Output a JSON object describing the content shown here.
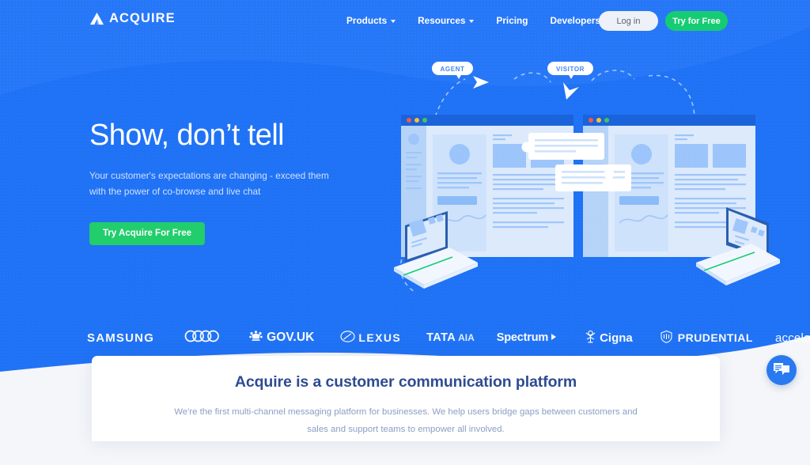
{
  "brand": {
    "name": "ACQUIRE",
    "logo_icon": "mountain-triangle-icon",
    "colors": {
      "blue": "#1f72f5",
      "blue_dark": "#1769ef",
      "green": "#22cd6c",
      "navy_text": "#2e4c91",
      "muted_text": "#8b9ec4",
      "hero_sub": "#cfe0ff"
    }
  },
  "header": {
    "nav": [
      {
        "label": "Products",
        "has_dropdown": true,
        "icon": "chevron-down-icon"
      },
      {
        "label": "Resources",
        "has_dropdown": true,
        "icon": "chevron-down-icon"
      },
      {
        "label": "Pricing",
        "has_dropdown": false
      },
      {
        "label": "Developers API",
        "has_dropdown": false
      }
    ],
    "login_label": "Log in",
    "signup_label": "Try for Free"
  },
  "hero": {
    "title": "Show, don’t tell",
    "subtitle": "Your customer's expectations are changing - exceed them with the power of co-browse and live chat",
    "cta_label": "Try Acquire For Free"
  },
  "illustration": {
    "agent_label": "AGENT",
    "visitor_label": "VISITOR",
    "icons": [
      "dashed-arrow-icon",
      "browser-window-icon",
      "laptop-icon",
      "chat-bubble-icon",
      "traffic-light-dots-icon"
    ]
  },
  "logos": [
    {
      "name": "SAMSUNG",
      "icon": "samsung-wordmark"
    },
    {
      "name": "Audi",
      "icon": "audi-rings-icon"
    },
    {
      "name": "GOV.UK",
      "icon": "crown-icon"
    },
    {
      "name": "LEXUS",
      "icon": "lexus-emblem-icon"
    },
    {
      "name": "TATA",
      "sub": "AIA",
      "icon": "tata-aia-wordmark"
    },
    {
      "name": "Spectrum",
      "icon": "spectrum-arrow-icon"
    },
    {
      "name": "Cigna",
      "icon": "cigna-tree-icon"
    },
    {
      "name": "PRUDENTIAL",
      "icon": "prudential-crest-icon"
    },
    {
      "name": "accelo",
      "icon": "accelo-lines-icon"
    }
  ],
  "card": {
    "title": "Acquire is a customer communication platform",
    "subtitle": "We're the first multi-channel messaging platform for businesses. We help users bridge gaps between customers and sales and support teams to empower all involved."
  },
  "chat_widget": {
    "icon": "chat-bubbles-icon",
    "color": "#2979f0"
  }
}
